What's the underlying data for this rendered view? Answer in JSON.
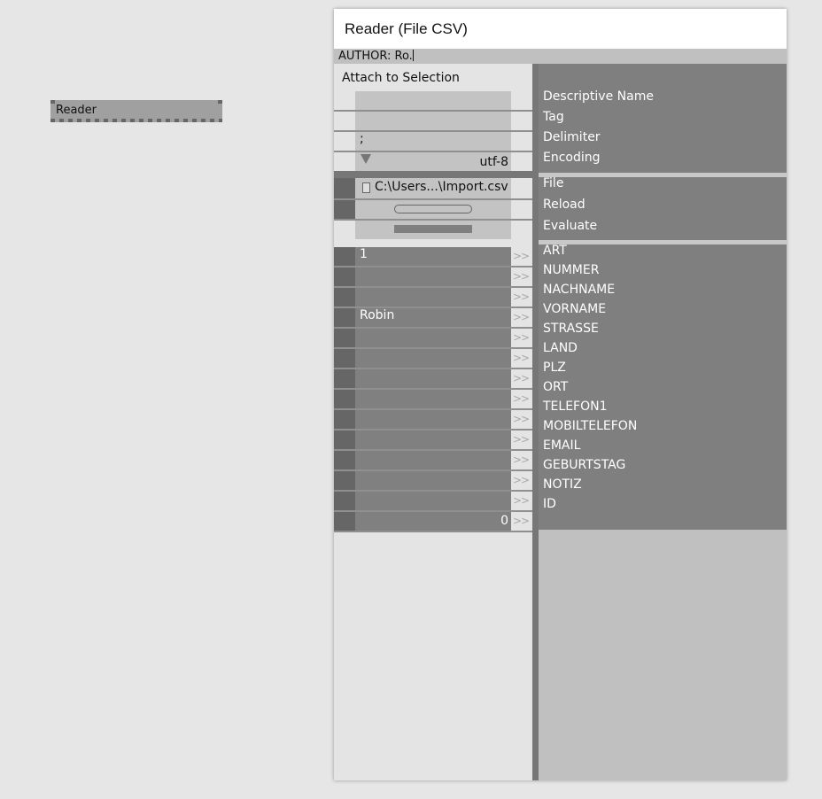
{
  "canvas_node": {
    "label": "Reader"
  },
  "window": {
    "title": "Reader (File CSV)",
    "author_line": "AUTHOR: Ro."
  },
  "left": {
    "attach_label": "Attach to Selection",
    "delimiter_value": ";",
    "encoding_value": "utf-8",
    "file_value": "C:\\Users...\\Import.csv",
    "field_values": [
      "1",
      "",
      "",
      "Robin",
      "",
      "",
      "",
      "",
      "",
      "",
      "",
      "",
      "",
      ""
    ],
    "arrow_glyph": ">>",
    "count_value": "0"
  },
  "right": {
    "config_labels": [
      "Descriptive Name",
      "Tag",
      "Delimiter",
      "Encoding"
    ],
    "action_labels": [
      "File",
      "Reload",
      "Evaluate"
    ],
    "field_labels": [
      "ART",
      "NUMMER",
      "NACHNAME",
      "VORNAME",
      "STRASSE",
      "LAND",
      "PLZ",
      "ORT",
      "TELEFON1",
      "MOBILTELEFON",
      "EMAIL",
      "GEBURTSTAG",
      "NOTIZ",
      "ID"
    ]
  }
}
